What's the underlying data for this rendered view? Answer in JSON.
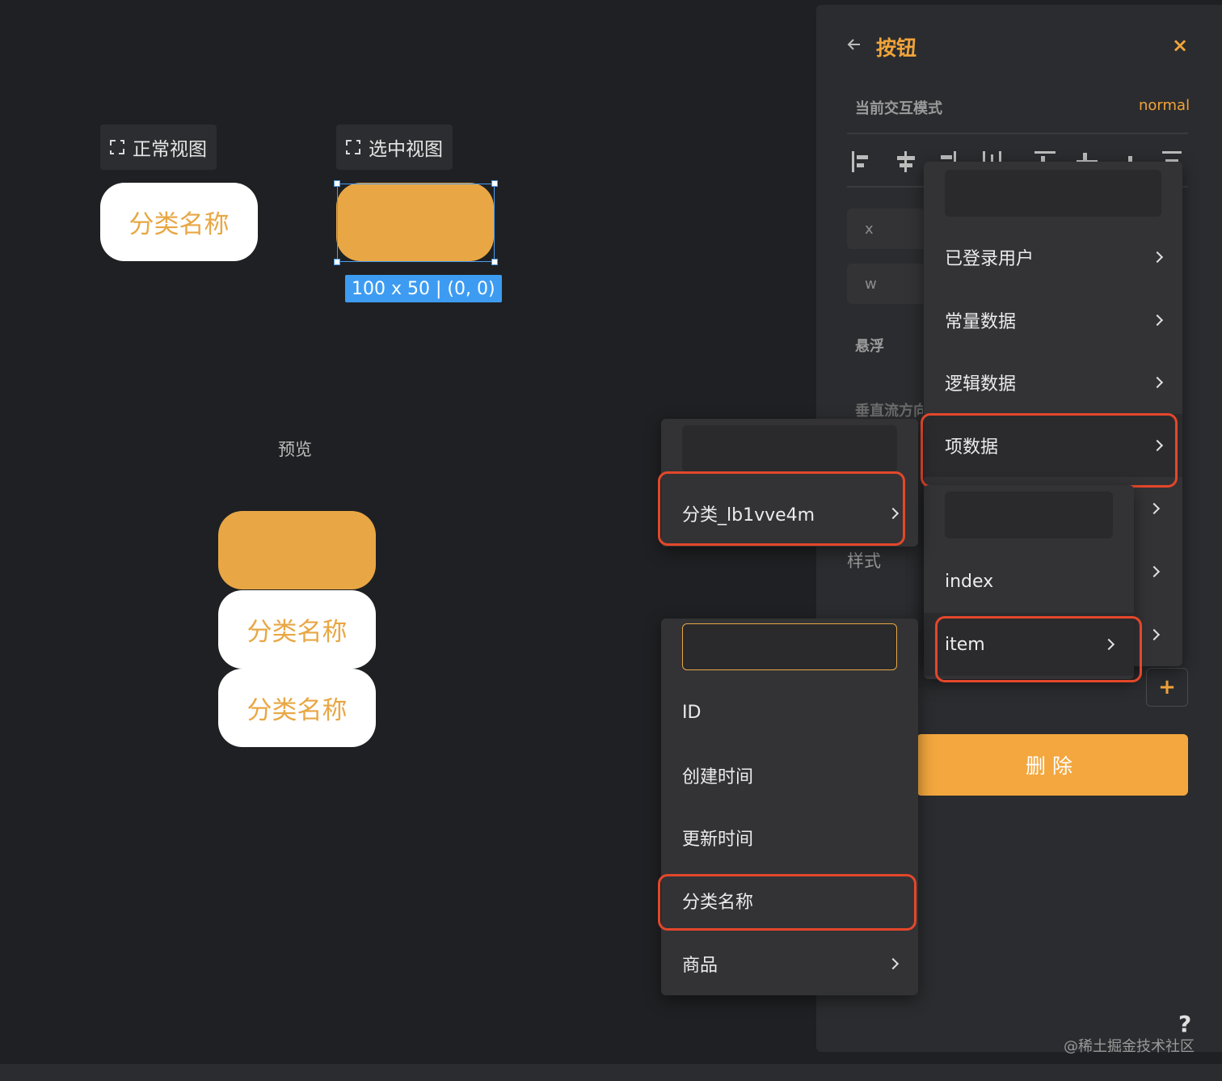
{
  "canvas": {
    "normal_view_label": "正常视图",
    "selected_view_label": "选中视图",
    "button_text": "分类名称",
    "size_tag": "100 x 50 | (0, 0)",
    "preview_label": "预览",
    "preview_items": [
      "分类名称",
      "分类名称"
    ]
  },
  "panel": {
    "title": "按钮",
    "close": "×",
    "mode_label": "当前交互模式",
    "mode_value": "normal",
    "field_x": "x",
    "field_w": "w",
    "hover_label": "悬浮",
    "vertical_flow_label": "垂直流方向",
    "style_label": "样式",
    "plus": "+",
    "delete_label": "删除",
    "help": "?",
    "watermark": "@稀土掘金技术社区"
  },
  "menu_main": {
    "items": [
      {
        "label": "已登录用户"
      },
      {
        "label": "常量数据"
      },
      {
        "label": "逻辑数据"
      },
      {
        "label": "项数据"
      }
    ]
  },
  "menu_item_data": {
    "items": [
      {
        "label": "index"
      },
      {
        "label": "item"
      }
    ]
  },
  "menu_category": {
    "items": [
      {
        "label": "分类_lb1vve4m"
      }
    ]
  },
  "menu_fields": {
    "items": [
      {
        "label": "ID"
      },
      {
        "label": "创建时间"
      },
      {
        "label": "更新时间"
      },
      {
        "label": "分类名称"
      },
      {
        "label": "商品"
      }
    ]
  },
  "colors": {
    "accent": "#e8a744",
    "highlight": "#e4472a",
    "selection": "#3d9cf2"
  }
}
